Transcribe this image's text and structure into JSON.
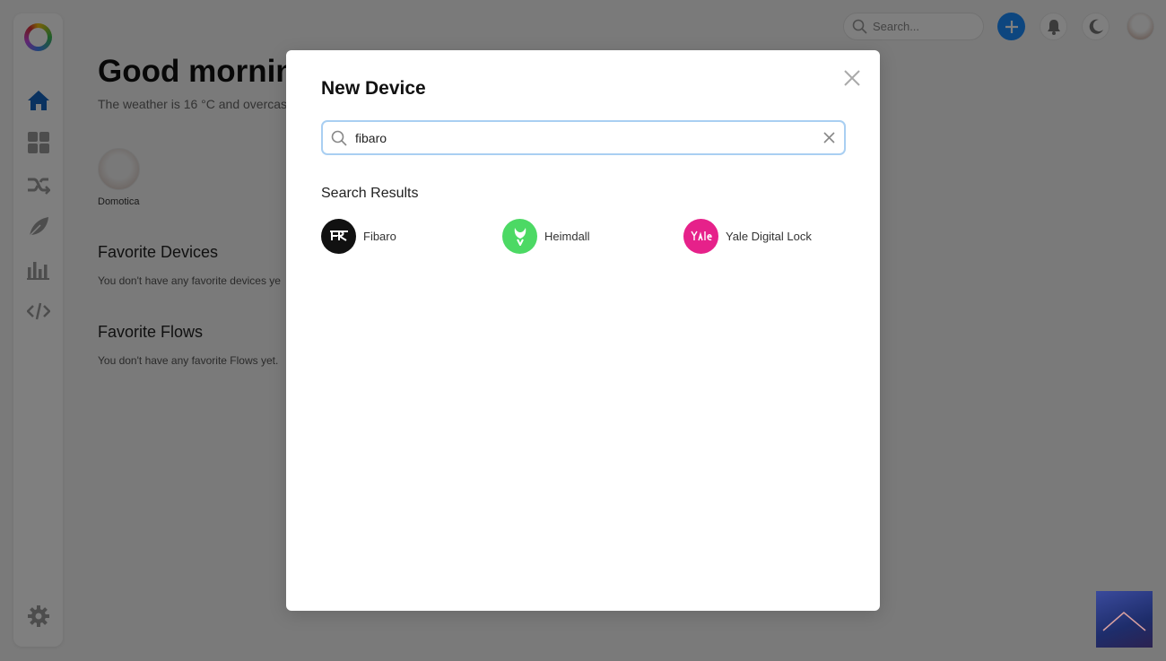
{
  "sidebar": {
    "logo": "homey-logo",
    "items": [
      {
        "icon": "home-icon",
        "active": true
      },
      {
        "icon": "dashboard-icon"
      },
      {
        "icon": "flows-icon"
      },
      {
        "icon": "leaf-icon"
      },
      {
        "icon": "insights-icon"
      },
      {
        "icon": "code-icon"
      }
    ],
    "settings_icon": "gear-icon"
  },
  "main": {
    "greeting": "Good morning",
    "weather": "The weather is 16 °C and overcas",
    "zone_label": "Domotica",
    "favorite_devices_title": "Favorite Devices",
    "favorite_devices_text": "You don't have any favorite devices ye",
    "favorite_flows_title": "Favorite Flows",
    "favorite_flows_text": "You don't have any favorite Flows yet."
  },
  "topbar": {
    "search_placeholder": "Search..."
  },
  "modal": {
    "title": "New Device",
    "search_value": "fibaro",
    "results_title": "Search Results",
    "results": [
      {
        "label": "Fibaro",
        "color": "#111111",
        "glyph": "FIBARO"
      },
      {
        "label": "Heimdall",
        "color": "#4cd964",
        "glyph": "H"
      },
      {
        "label": "Yale Digital Lock",
        "color": "#e6218a",
        "glyph": "Yale"
      }
    ]
  },
  "colors": {
    "accent": "#1a8cff",
    "sidebar_active": "#1565c0",
    "search_border": "#a9cff2"
  }
}
